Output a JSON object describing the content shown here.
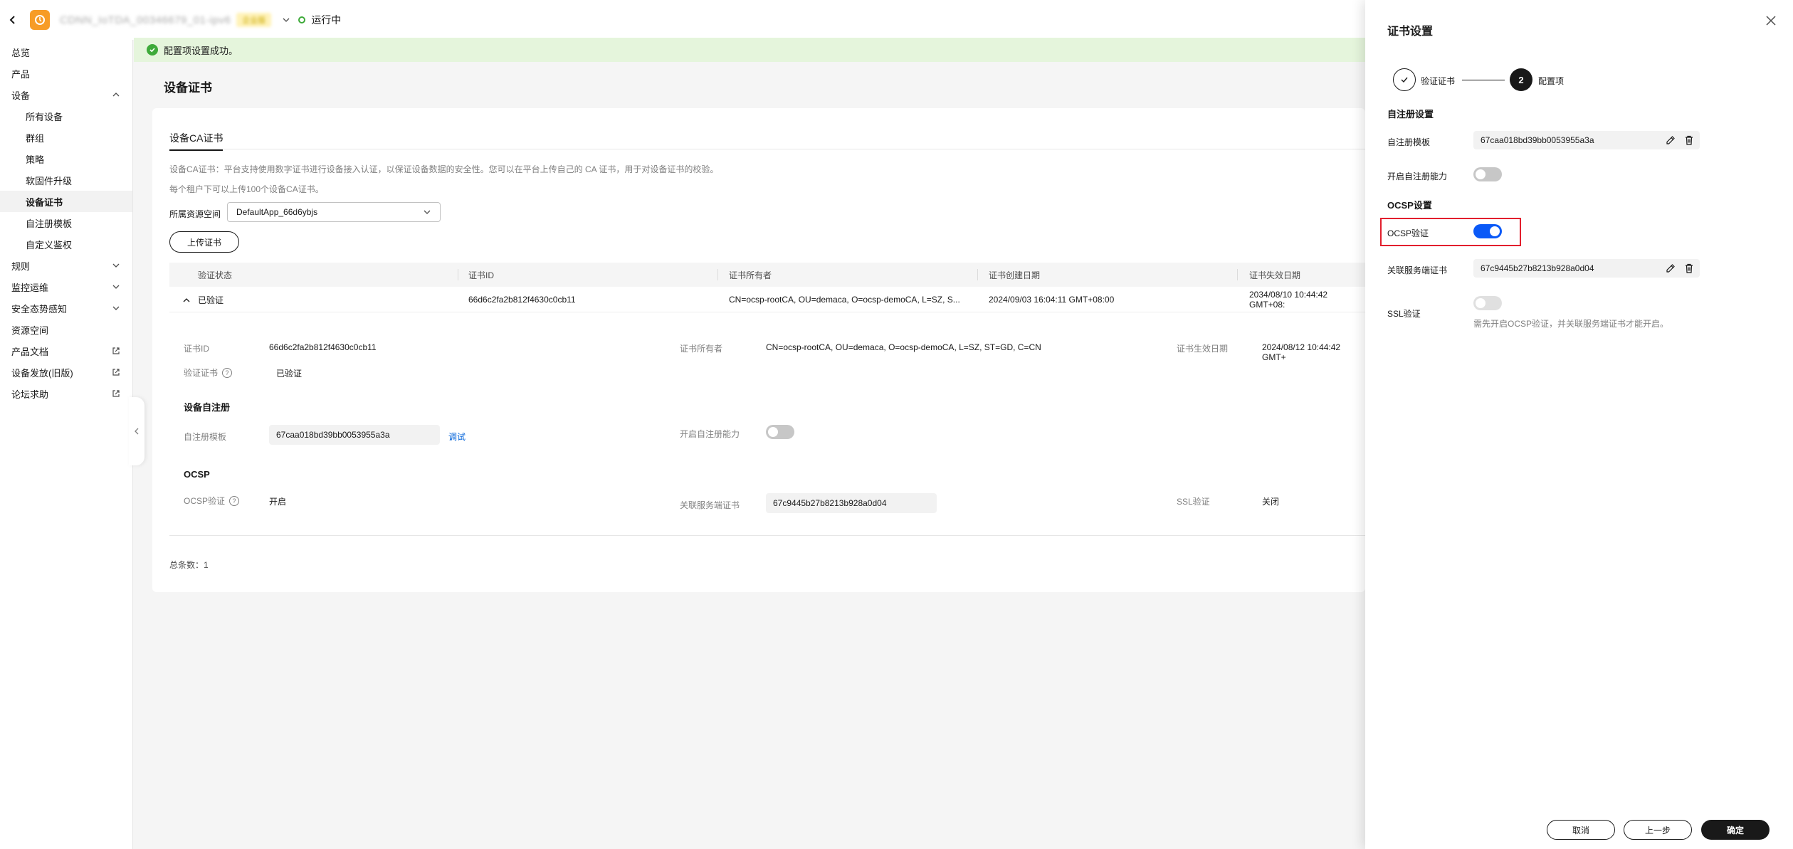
{
  "topbar": {
    "instance_name": "CDNN_IoTDA_00346679_01-ipv6",
    "instance_tag": "企业版",
    "status": "运行中"
  },
  "sidebar": {
    "items": [
      {
        "label": "总览"
      },
      {
        "label": "产品"
      },
      {
        "label": "设备"
      },
      {
        "label": "所有设备"
      },
      {
        "label": "群组"
      },
      {
        "label": "策略"
      },
      {
        "label": "软固件升级"
      },
      {
        "label": "设备证书"
      },
      {
        "label": "自注册模板"
      },
      {
        "label": "自定义鉴权"
      },
      {
        "label": "规则"
      },
      {
        "label": "监控运维"
      },
      {
        "label": "安全态势感知"
      },
      {
        "label": "资源空间"
      },
      {
        "label": "产品文档"
      },
      {
        "label": "设备发放(旧版)"
      },
      {
        "label": "论坛求助"
      }
    ]
  },
  "notice": {
    "text": "配置项设置成功。"
  },
  "main": {
    "title": "设备证书",
    "tab": "设备CA证书",
    "desc1": "设备CA证书：平台支持使用数字证书进行设备接入认证，以保证设备数据的安全性。您可以在平台上传自己的 CA 证书，用于对设备证书的校验。",
    "desc2": "每个租户下可以上传100个设备CA证书。",
    "resource_space_label": "所属资源空间",
    "resource_space_value": "DefaultApp_66d6ybjs",
    "upload_button": "上传证书",
    "columns": [
      "验证状态",
      "证书ID",
      "证书所有者",
      "证书创建日期",
      "证书失效日期"
    ],
    "row": {
      "status": "已验证",
      "cert_id": "66d6c2fa2b812f4630c0cb11",
      "owner": "CN=ocsp-rootCA, OU=demaca, O=ocsp-demoCA, L=SZ, S...",
      "created": "2024/09/03 16:04:11 GMT+08:00",
      "expires": "2034/08/10 10:44:42 GMT+08:"
    },
    "detail": {
      "cert_id_label": "证书ID",
      "cert_id": "66d6c2fa2b812f4630c0cb11",
      "owner_label": "证书所有者",
      "owner": "CN=ocsp-rootCA, OU=demaca, O=ocsp-demoCA, L=SZ, ST=GD, C=CN",
      "effective_label": "证书生效日期",
      "effective": "2024/08/12 10:44:42 GMT+",
      "verify_label": "验证证书",
      "verify_value": "已验证",
      "self_reg_title": "设备自注册",
      "template_label": "自注册模板",
      "template_value": "67caa018bd39bb0053955a3a",
      "debug_link": "调试",
      "enable_self_reg_label": "开启自注册能力",
      "ocsp_title": "OCSP",
      "ocsp_label": "OCSP验证",
      "ocsp_value": "开启",
      "server_cert_label": "关联服务端证书",
      "server_cert_value": "67c9445b27b8213b928a0d04",
      "ssl_label": "SSL验证",
      "ssl_value": "关闭"
    },
    "total": "总条数：1"
  },
  "drawer": {
    "title": "证书设置",
    "step1": "验证证书",
    "step2_num": "2",
    "step2": "配置项",
    "self_reg_section": "自注册设置",
    "template_label": "自注册模板",
    "template_value": "67caa018bd39bb0053955a3a",
    "enable_self_reg_label": "开启自注册能力",
    "enable_self_reg_on": false,
    "ocsp_section": "OCSP设置",
    "ocsp_label": "OCSP验证",
    "ocsp_on": true,
    "server_cert_label": "关联服务端证书",
    "server_cert_value": "67c9445b27b8213b928a0d04",
    "ssl_label": "SSL验证",
    "ssl_on": false,
    "ssl_hint": "需先开启OCSP验证，并关联服务端证书才能开启。",
    "cancel": "取消",
    "prev": "上一步",
    "confirm": "确定"
  },
  "colors": {
    "accent": "#0a59f7",
    "success": "#3eaa3a",
    "highlight": "#e21f2d",
    "primary_button": "#191919"
  }
}
